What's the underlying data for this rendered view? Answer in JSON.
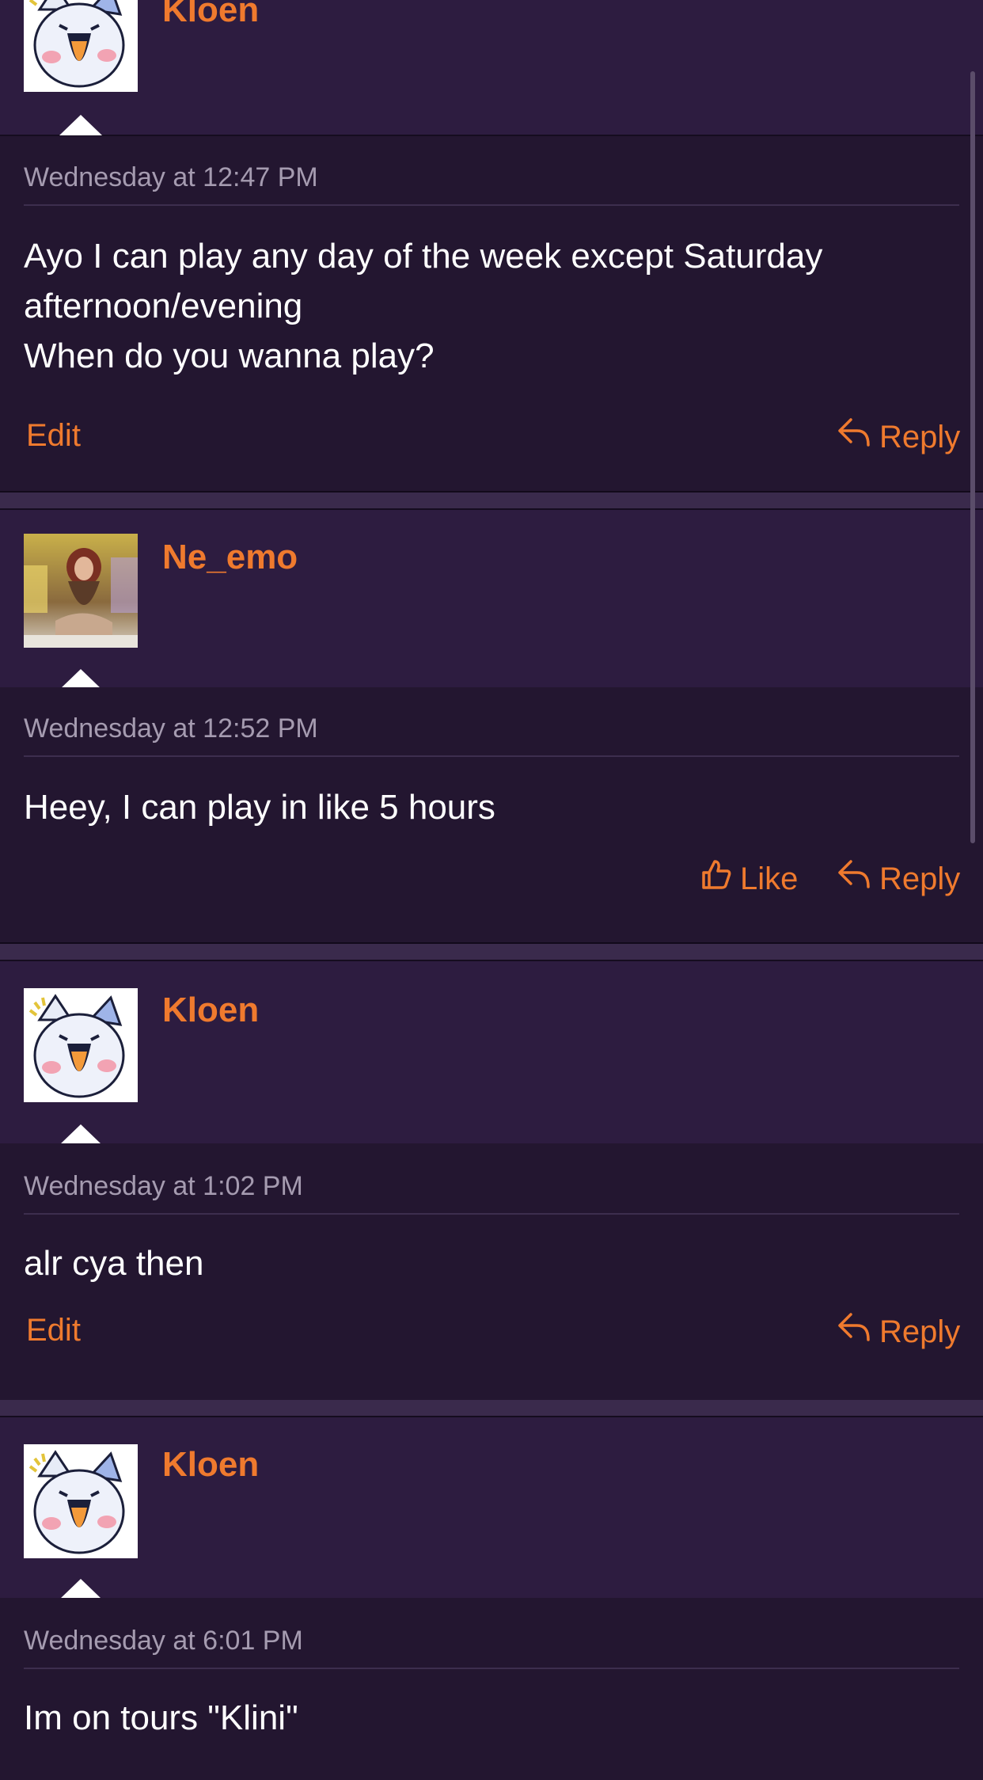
{
  "posts": [
    {
      "username": "Kloen",
      "timestamp": "Wednesday at 12:47 PM",
      "message": "Ayo I can play any day of the week except Saturday afternoon/evening\nWhen do you wanna play?",
      "left_action": "Edit",
      "reply": "Reply",
      "avatar": "cartoon-cat-avatar"
    },
    {
      "username": "Ne_emo",
      "timestamp": "Wednesday at 12:52 PM",
      "message": "Heey, I can play in like 5 hours",
      "like": "Like",
      "reply": "Reply",
      "avatar": "photo-avatar"
    },
    {
      "username": "Kloen",
      "timestamp": "Wednesday at 1:02 PM",
      "message": "alr cya then",
      "left_action": "Edit",
      "reply": "Reply",
      "avatar": "cartoon-cat-avatar"
    },
    {
      "username": "Kloen",
      "timestamp": "Wednesday at 6:01 PM",
      "message": "Im on tours \"Klini\"",
      "avatar": "cartoon-cat-avatar"
    }
  ],
  "colors": {
    "accent": "#ef7a2e",
    "header_bg": "#2d1c40",
    "body_bg": "#231630",
    "text": "#ffffff",
    "muted": "#a59bb0"
  }
}
